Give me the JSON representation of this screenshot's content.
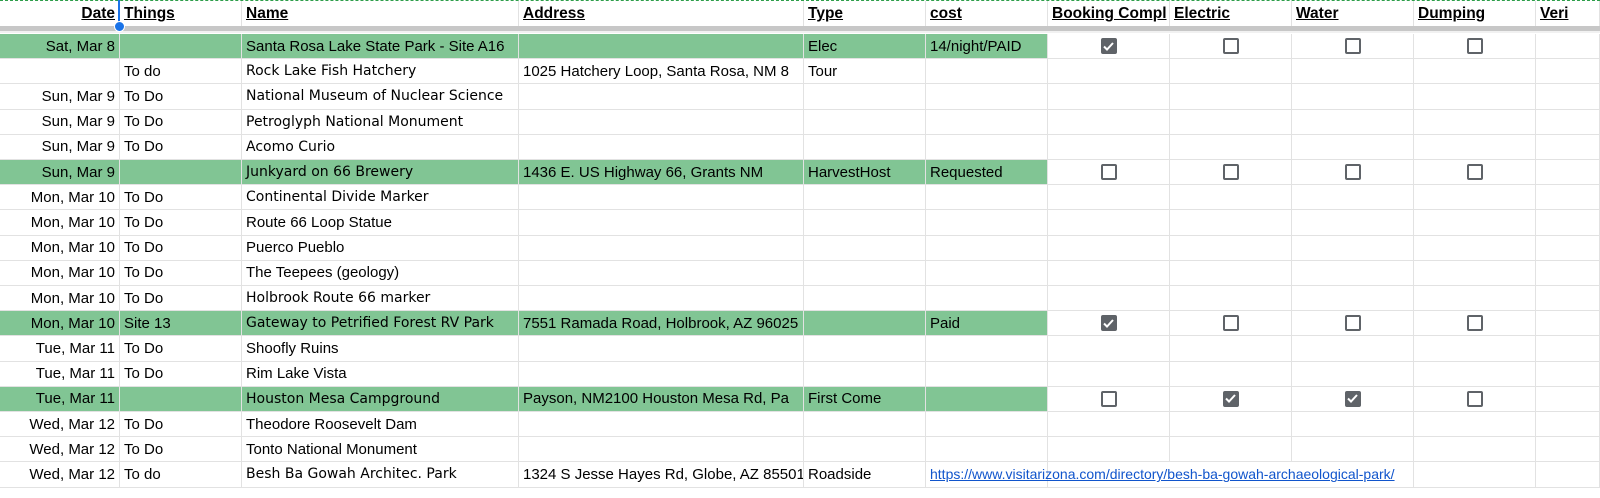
{
  "headers": [
    "Date",
    "Things",
    "Name",
    "Address",
    "Type",
    "cost",
    "Booking Compl",
    "Electric",
    "Water",
    "Dumping",
    "Veri"
  ],
  "rows": [
    {
      "date": "Sat, Mar 8",
      "things": "",
      "name": "Santa Rosa Lake State Park - Site A16",
      "address": "",
      "type": "Elec",
      "cost": "14/night/PAID",
      "booking": true,
      "electric": false,
      "water": false,
      "dumping": false,
      "highlight": true,
      "checks": true
    },
    {
      "date": "",
      "things": "To do",
      "name": "Rock Lake Fish Hatchery",
      "address": "1025 Hatchery Loop, Santa Rosa, NM 8",
      "type": "Tour",
      "cost": "",
      "highlight": false,
      "checks": false,
      "nameStyle": "serif"
    },
    {
      "date": "Sun, Mar 9",
      "things": "To Do",
      "name": "National Museum of Nuclear Science",
      "address": "",
      "type": "",
      "cost": "",
      "highlight": false,
      "checks": false,
      "nameStyle": "serif"
    },
    {
      "date": "Sun, Mar 9",
      "things": "To Do",
      "name": "Petroglyph National Monument",
      "address": "",
      "type": "",
      "cost": "",
      "highlight": false,
      "checks": false,
      "nameStyle": "serif"
    },
    {
      "date": "Sun, Mar 9",
      "things": "To Do",
      "name": "Acomo Curio",
      "address": "",
      "type": "",
      "cost": "",
      "highlight": false,
      "checks": false,
      "nameStyle": "serif"
    },
    {
      "date": "Sun, Mar 9",
      "things": "",
      "name": "Junkyard on 66 Brewery",
      "address": "1436 E. US Highway 66, Grants NM",
      "type": "HarvestHost",
      "cost": "Requested",
      "booking": false,
      "electric": false,
      "water": false,
      "dumping": false,
      "highlight": true,
      "checks": true,
      "nameStyle": "serif"
    },
    {
      "date": "Mon, Mar 10",
      "things": "To Do",
      "name": "Continental Divide Marker",
      "address": "",
      "type": "",
      "cost": "",
      "highlight": false,
      "checks": false,
      "nameStyle": "serif"
    },
    {
      "date": "Mon, Mar 10",
      "things": "To Do",
      "name": "Route 66 Loop Statue",
      "address": "",
      "type": "",
      "cost": "",
      "highlight": false,
      "checks": false
    },
    {
      "date": "Mon, Mar 10",
      "things": "To Do",
      "name": "Puerco Pueblo",
      "address": "",
      "type": "",
      "cost": "",
      "highlight": false,
      "checks": false
    },
    {
      "date": "Mon, Mar 10",
      "things": "To Do",
      "name": "The Teepees (geology)",
      "address": "",
      "type": "",
      "cost": "",
      "highlight": false,
      "checks": false
    },
    {
      "date": "Mon, Mar 10",
      "things": "To Do",
      "name": "Holbrook Route 66 marker",
      "address": "",
      "type": "",
      "cost": "",
      "highlight": false,
      "checks": false,
      "nameStyle": "serif"
    },
    {
      "date": "Mon, Mar 10",
      "things": "Site 13",
      "name": "Gateway to Petrified Forest RV Park",
      "address": "7551 Ramada Road, Holbrook, AZ 96025",
      "type": "",
      "cost": "Paid",
      "booking": true,
      "electric": false,
      "water": false,
      "dumping": false,
      "highlight": true,
      "checks": true,
      "nameStyle": "serif"
    },
    {
      "date": "Tue, Mar 11",
      "things": "To Do",
      "name": "Shoofly Ruins",
      "address": "",
      "type": "",
      "cost": "",
      "highlight": false,
      "checks": false
    },
    {
      "date": "Tue, Mar 11",
      "things": "To Do",
      "name": "Rim Lake Vista",
      "address": "",
      "type": "",
      "cost": "",
      "highlight": false,
      "checks": false
    },
    {
      "date": "Tue, Mar 11",
      "things": "",
      "name": "Houston Mesa Campground",
      "address": "Payson, NM2100 Houston Mesa Rd, Pa",
      "type": "First Come",
      "cost": "",
      "booking": false,
      "electric": true,
      "water": true,
      "dumping": false,
      "highlight": true,
      "checks": true,
      "nameStyle": "serif"
    },
    {
      "date": "Wed, Mar 12",
      "things": "To Do",
      "name": "Theodore Roosevelt Dam",
      "address": "",
      "type": "",
      "cost": "",
      "highlight": false,
      "checks": false
    },
    {
      "date": "Wed, Mar 12",
      "things": "To Do",
      "name": "Tonto National Monument",
      "address": "",
      "type": "",
      "cost": "",
      "highlight": false,
      "checks": false
    },
    {
      "date": "Wed, Mar 12",
      "things": "To do",
      "name": "Besh Ba Gowah Architec. Park",
      "address": "1324 S Jesse Hayes Rd, Globe, AZ 85501",
      "type": "Roadside",
      "cost": "https://www.visitarizona.com/directory/besh-ba-gowah-archaeological-park/",
      "costLink": true,
      "highlight": false,
      "checks": false,
      "nameStyle": "serif"
    }
  ],
  "colors": {
    "highlight": "#81c594",
    "grid": "#e2e2e2",
    "checkbox": "#5f6368",
    "link": "#1155cc",
    "selection": "#1a73e8"
  }
}
